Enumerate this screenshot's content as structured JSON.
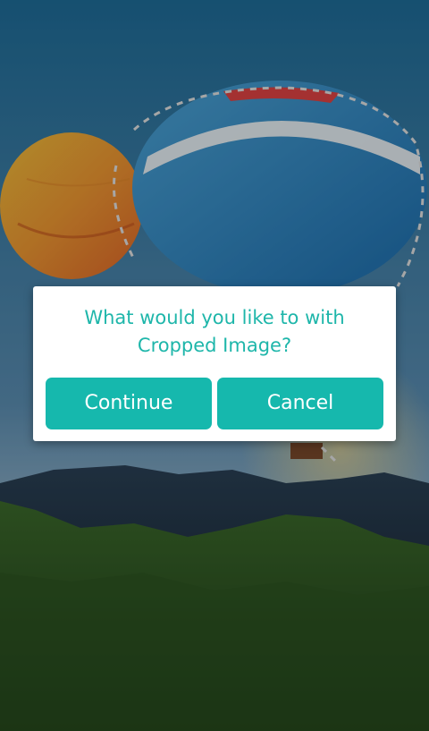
{
  "background": {
    "description_icon": "hot-air-balloon-photo"
  },
  "dialog": {
    "message": "What would you like to with\nCropped Image?",
    "continue_label": "Continue",
    "cancel_label": "Cancel"
  },
  "colors": {
    "accent": "#16b8ad",
    "message_text": "#1eb6aa",
    "dialog_bg": "#ffffff"
  }
}
